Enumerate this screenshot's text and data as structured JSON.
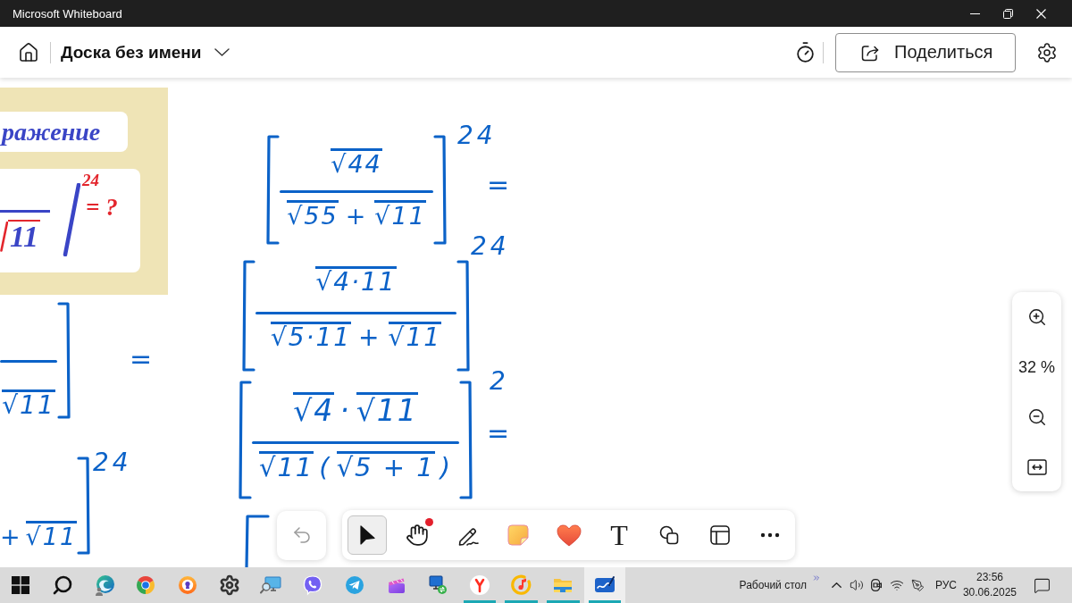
{
  "window": {
    "title": "Microsoft Whiteboard"
  },
  "header": {
    "board_title": "Доска без имени",
    "share_label": "Поделиться"
  },
  "canvas": {
    "slide": {
      "heading": "ражение",
      "radicand": "11",
      "exponent": "24",
      "equals": "= ?"
    },
    "ink": [
      {
        "denominator": [
          {
            "text": "√11",
            "radical": true
          }
        ],
        "equals": "="
      },
      {
        "denominator": [
          {
            "text": "+",
            "radical": false
          },
          {
            "text": "√11",
            "radical": true
          }
        ],
        "exponent": "24"
      },
      {
        "numerator": [
          {
            "text": "√44",
            "radical": true
          }
        ],
        "denominator": [
          {
            "text": "√55",
            "radical": true
          },
          {
            "text": "+",
            "radical": false
          },
          {
            "text": "√11",
            "radical": true
          }
        ],
        "exponent": "24",
        "equals": "="
      },
      {
        "numerator": [
          {
            "text": "√4·11",
            "radical": true
          }
        ],
        "denominator": [
          {
            "text": "√5·11",
            "radical": true
          },
          {
            "text": "+",
            "radical": false
          },
          {
            "text": "√11",
            "radical": true
          }
        ],
        "exponent": "24"
      },
      {
        "numerator": [
          {
            "text": "√4",
            "radical": true
          },
          {
            "text": "·",
            "radical": false
          },
          {
            "text": "√11",
            "radical": true
          }
        ],
        "denominator": [
          {
            "text": "√11",
            "radical": true
          },
          {
            "text": "(",
            "radical": false
          },
          {
            "text": "√5 + 1",
            "radical": true
          },
          {
            "text": ")",
            "radical": false
          }
        ],
        "exponent": "2",
        "equals": "="
      }
    ]
  },
  "zoom_panel": {
    "level_text": "32 %"
  },
  "toolbar": {
    "undo": {
      "disabled": true
    },
    "tools": [
      {
        "kind": "pointer",
        "selected": true,
        "dot": false
      },
      {
        "kind": "hand",
        "selected": false,
        "dot": true
      },
      {
        "kind": "pen",
        "selected": false,
        "dot": false
      },
      {
        "kind": "note",
        "selected": false,
        "dot": false
      },
      {
        "kind": "sticker",
        "selected": false,
        "dot": false
      },
      {
        "kind": "text",
        "glyph": "T",
        "selected": false,
        "dot": false
      },
      {
        "kind": "shapes",
        "selected": false,
        "dot": false
      },
      {
        "kind": "template",
        "selected": false,
        "dot": false
      },
      {
        "kind": "more",
        "selected": false,
        "dot": false
      }
    ]
  },
  "taskbar": {
    "apps": [
      {
        "kind": "start",
        "running": false,
        "selected": false
      },
      {
        "kind": "search",
        "running": false,
        "selected": false
      },
      {
        "kind": "edge",
        "running": false,
        "selected": false
      },
      {
        "kind": "chrome",
        "running": false,
        "selected": false
      },
      {
        "kind": "lock_browser",
        "running": false,
        "selected": false
      },
      {
        "kind": "settings",
        "running": false,
        "selected": false
      },
      {
        "kind": "monitor",
        "running": false,
        "selected": false
      },
      {
        "kind": "viber",
        "running": false,
        "selected": false
      },
      {
        "kind": "telegram",
        "running": false,
        "selected": false
      },
      {
        "kind": "clapper",
        "running": false,
        "selected": false
      },
      {
        "kind": "remote",
        "running": false,
        "selected": false
      },
      {
        "kind": "yandex",
        "running": true,
        "selected": false
      },
      {
        "kind": "music",
        "running": true,
        "selected": false
      },
      {
        "kind": "folder",
        "running": true,
        "selected": false
      },
      {
        "kind": "whiteboard",
        "running": true,
        "selected": true
      }
    ],
    "desktop_label": "Рабочий стол",
    "language": "РУС",
    "time": "23:56",
    "date": "30.06.2025"
  }
}
